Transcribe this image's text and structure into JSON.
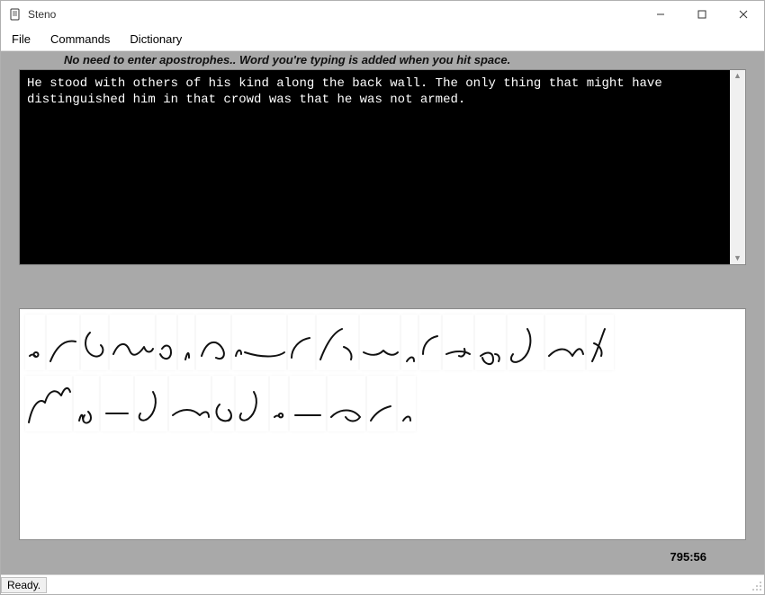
{
  "window": {
    "title": "Steno",
    "icon": "document-icon",
    "controls": {
      "minimize": "minimize-icon",
      "maximize": "maximize-icon",
      "close": "close-icon"
    }
  },
  "menubar": {
    "items": [
      "File",
      "Commands",
      "Dictionary"
    ]
  },
  "hint": "No need to enter apostrophes.. Word you're typing is  added when you hit space.",
  "editor": {
    "text": "He stood with others of his kind along the back wall. The only thing that might have\ndistinguished him in that crowd was that he was not armed."
  },
  "steno": {
    "rows": [
      [
        "he",
        "stood",
        "with",
        "others",
        "of",
        "his",
        "kind",
        "along",
        "the",
        "back",
        "wall",
        "period",
        "the2",
        "only",
        "thing",
        "that",
        "might",
        "have"
      ],
      [
        "distinguished",
        "him",
        "in",
        "that2",
        "crowd",
        "was",
        "that3",
        "he2",
        "was2",
        "not",
        "armed",
        "period2"
      ]
    ]
  },
  "timer": "795:56",
  "status": {
    "text": "Ready."
  }
}
